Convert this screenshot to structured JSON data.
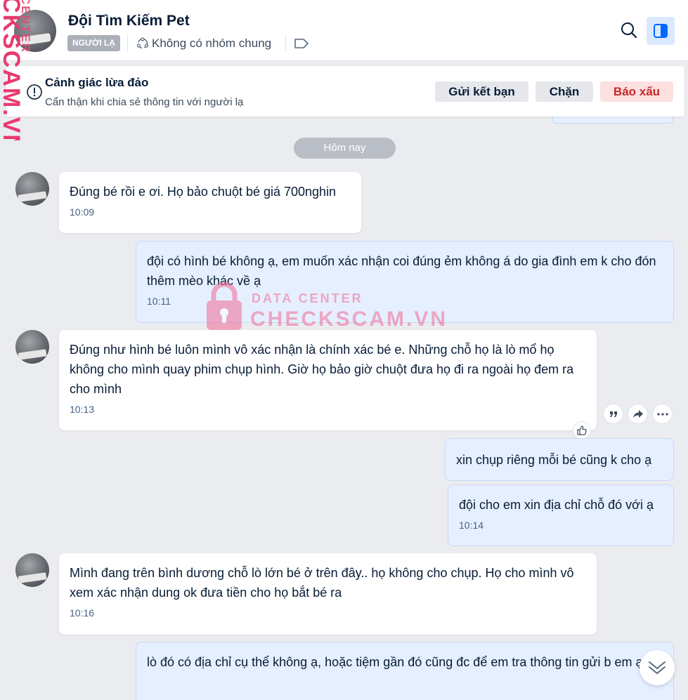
{
  "header": {
    "title": "Đội Tìm Kiếm Pet",
    "badge": "NGƯỜI LẠ",
    "no_group": "Không có nhóm chung",
    "icons": [
      "group-icon",
      "tag-icon",
      "search-icon",
      "panel-toggle-icon"
    ]
  },
  "warning": {
    "title": "Cảnh giác lừa đảo",
    "subtitle": "Cẩn thận khi chia sẻ thông tin với người lạ",
    "add_friend": "Gửi kết bạn",
    "block": "Chặn",
    "report": "Báo xấu"
  },
  "date_divider": "Hôm nay",
  "messages": [
    {
      "side": "in",
      "text": "Đúng bé rồi e ơi. Họ bảo chuột bé giá 700nghin",
      "time": "10:09"
    },
    {
      "side": "out",
      "text": "đội có hình bé không ạ, em muốn xác nhận coi đúng ẻm không á do gia đình em k cho đón thêm mèo khác về ạ",
      "time": "10:11"
    },
    {
      "side": "in",
      "text": "Đúng như hình bé luôn mình vô xác nhận là chính xác bé e. Những chỗ họ là lò mổ họ không cho mình quay phim chụp hình. Giờ họ bảo giờ chuột đưa họ đi ra ngoài họ đem ra cho mình",
      "time": "10:13"
    },
    {
      "side": "out",
      "text": "xin chụp riêng mỗi bé cũng k cho ạ",
      "time": ""
    },
    {
      "side": "out",
      "text": "đội cho em xin địa chỉ chỗ đó với ạ",
      "time": "10:14"
    },
    {
      "side": "in",
      "text": "Mình đang trên bình dương chỗ lò lớn bé ở trên đây.. họ không cho chụp. Họ cho mình vô xem xác nhận dung ok đưa tiền cho họ bắt bé ra",
      "time": "10:16"
    },
    {
      "side": "out",
      "text": "lò đó có địa chỉ cụ thể không ạ, hoặc tiệm gần đó cũng đc để em tra thông tin gửi b em ạ",
      "time": ""
    }
  ],
  "watermark": {
    "side_small": "CENTER",
    "side_large": "CKSCAM.VN",
    "line1": "DATA CENTER",
    "line2": "CHECKSCAM.VN"
  },
  "colors": {
    "accent": "#0068ff",
    "outgoing_bubble": "#e5efff",
    "report": "#c62828",
    "watermark": "#e83a6e"
  }
}
